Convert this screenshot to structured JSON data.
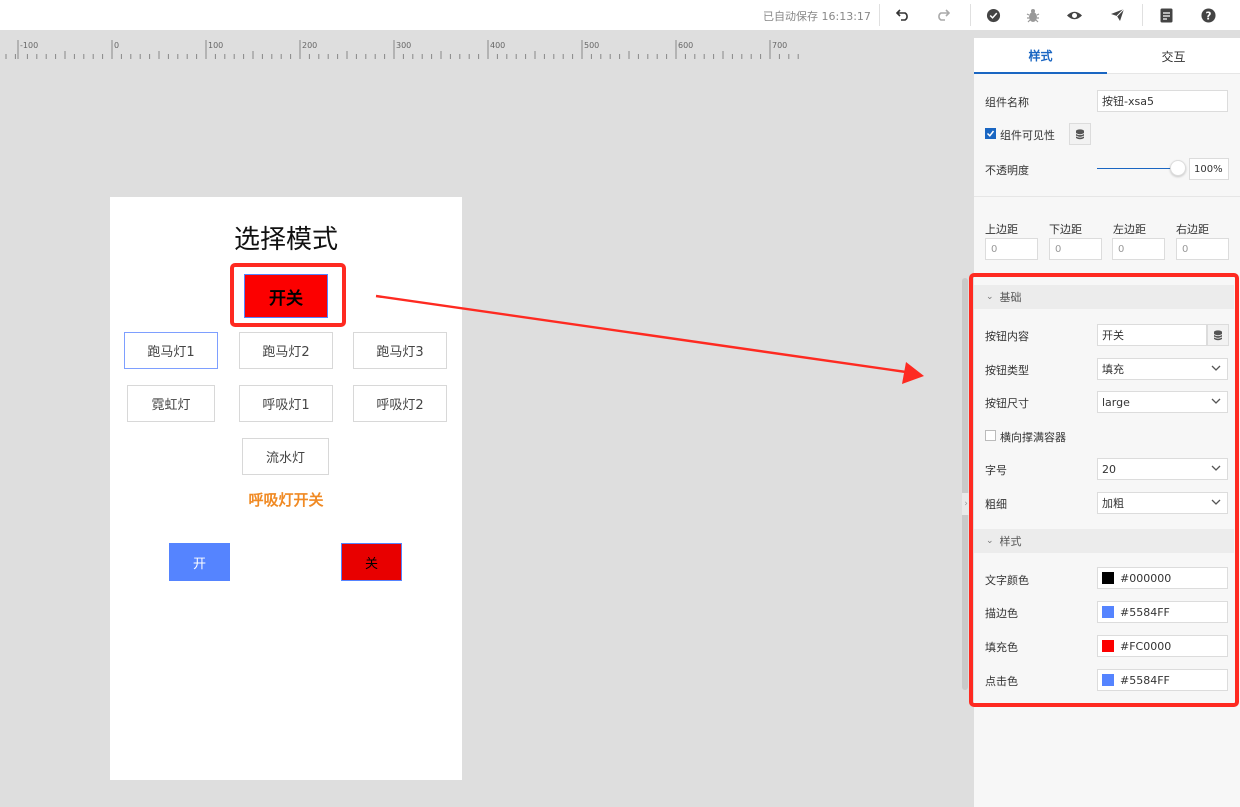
{
  "topbar": {
    "autosave": "已自动保存 16:13:17",
    "icons": [
      "undo-icon",
      "redo-icon",
      "check-icon",
      "debug-icon",
      "preview-icon",
      "publish-icon",
      "doc-icon",
      "help-icon"
    ]
  },
  "ruler": {
    "labels": [
      "-100",
      "0",
      "100",
      "200",
      "300",
      "400",
      "500",
      "600",
      "700"
    ]
  },
  "phone": {
    "title": "选择模式",
    "switch_btn": "开关",
    "modes": [
      "跑马灯1",
      "跑马灯2",
      "跑马灯3",
      "霓虹灯",
      "呼吸灯1",
      "呼吸灯2",
      "流水灯"
    ],
    "breath_label": "呼吸灯开关",
    "on_btn": "开",
    "off_btn": "关"
  },
  "panel": {
    "tabs": [
      "样式",
      "交互"
    ],
    "component_name_label": "组件名称",
    "component_name_value": "按钮-xsa5",
    "visible_label": "组件可见性",
    "opacity_label": "不透明度",
    "opacity_value": "100%",
    "margin_labels": [
      "上边距",
      "下边距",
      "左边距",
      "右边距"
    ],
    "margin_values": [
      "0",
      "0",
      "0",
      "0"
    ],
    "section_basic": "基础",
    "btn_content_label": "按钮内容",
    "btn_content_value": "开关",
    "btn_type_label": "按钮类型",
    "btn_type_value": "填充",
    "btn_size_label": "按钮尺寸",
    "btn_size_value": "large",
    "stretch_label": "横向撑满容器",
    "font_size_label": "字号",
    "font_size_value": "20",
    "weight_label": "粗细",
    "weight_value": "加粗",
    "section_style": "样式",
    "text_color_label": "文字颜色",
    "text_color_value": "#000000",
    "stroke_color_label": "描边色",
    "stroke_color_value": "#5584FF",
    "fill_color_label": "填充色",
    "fill_color_value": "#FC0000",
    "click_color_label": "点击色",
    "click_color_value": "#5584FF"
  },
  "colors": {
    "accent": "#1a66c2",
    "highlight": "#fe2a21",
    "button_blue": "#5584ff",
    "button_red": "#fc0000",
    "orange": "#f08a24"
  }
}
